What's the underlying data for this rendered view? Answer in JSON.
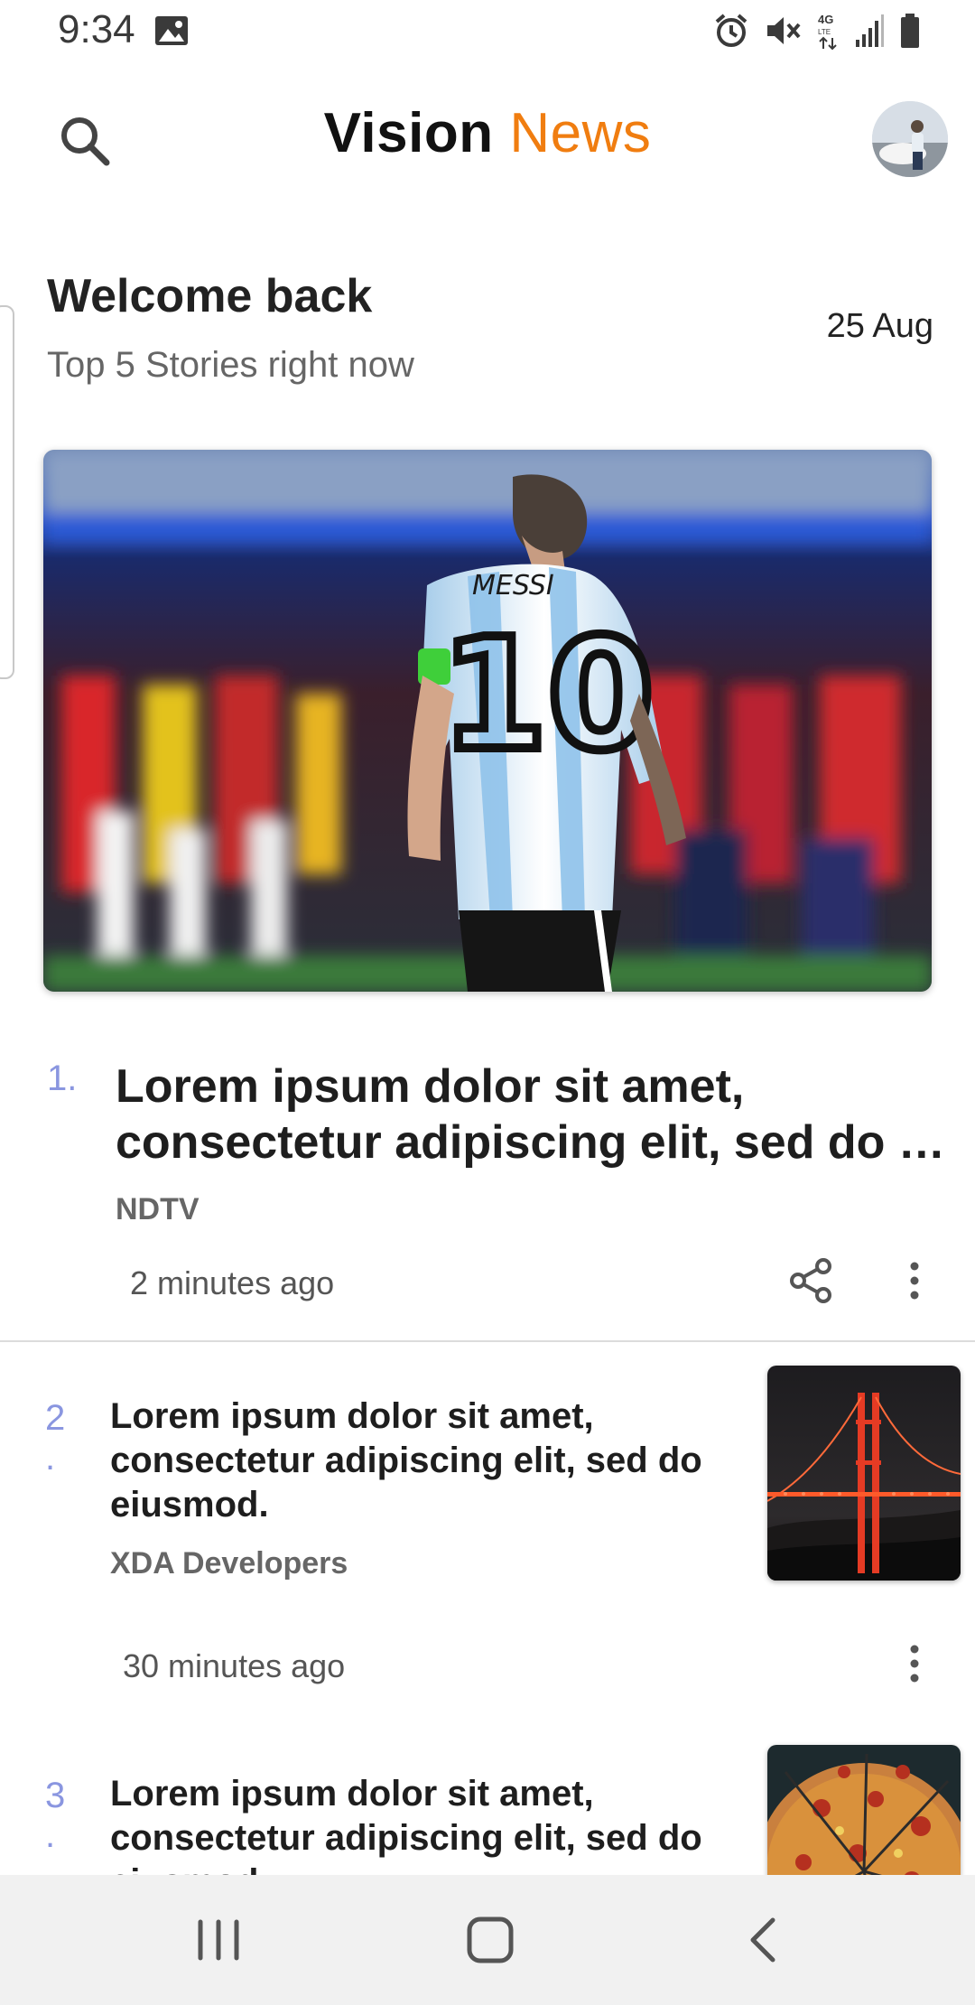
{
  "status_bar": {
    "time": "9:34",
    "icons": [
      "gallery-icon",
      "alarm-icon",
      "mute-icon",
      "network-4g-icon",
      "signal-icon",
      "battery-icon"
    ]
  },
  "app_bar": {
    "brand_part1": "Vision",
    "brand_part2": "News",
    "brand_accent_color": "#f07d10",
    "search_icon": "search-icon",
    "avatar_icon": "avatar"
  },
  "welcome": {
    "title": "Welcome back",
    "subtitle": "Top 5 Stories right now",
    "date": "25 Aug"
  },
  "stories": [
    {
      "number": "1.",
      "title_line1": "Lorem ipsum dolor sit amet,",
      "title_line2": "consectetur adipiscing elit, sed do ei…",
      "source": "NDTV",
      "time": "2 minutes ago"
    },
    {
      "number_top": "2",
      "number_bottom": ".",
      "title": "Lorem ipsum dolor sit amet, consectetur adipiscing elit, sed do eiusmod.",
      "source": "XDA Developers",
      "time": "30 minutes ago"
    },
    {
      "number_top": "3",
      "number_bottom": ".",
      "title": "Lorem ipsum dolor sit amet, consectetur adipiscing elit, sed do eiusmod."
    }
  ],
  "hero": {
    "jersey_name": "MESSI",
    "jersey_number": "10"
  },
  "colors": {
    "number_accent": "#8a96e0",
    "nav_background": "#f1f1f1"
  }
}
